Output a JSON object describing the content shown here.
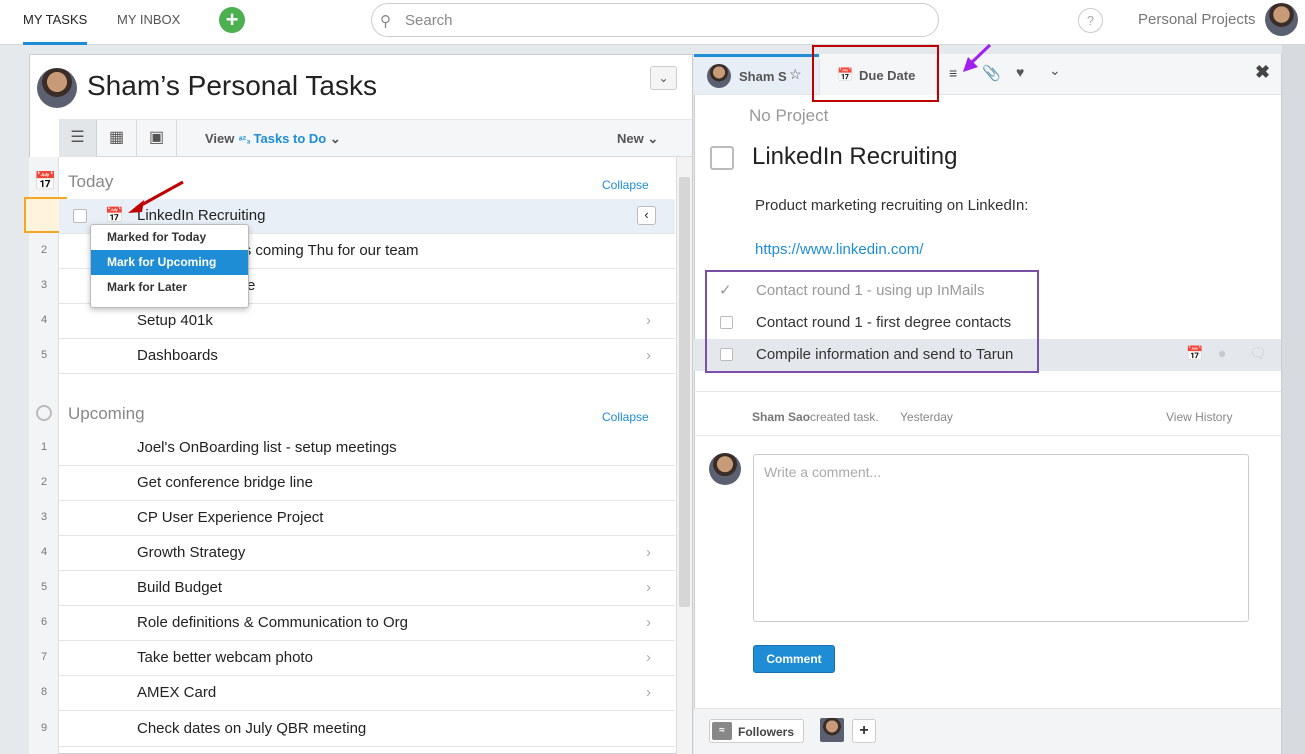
{
  "topnav": {
    "tabs": [
      "MY TASKS",
      "MY INBOX"
    ],
    "search_placeholder": "Search",
    "help": "?",
    "workspace": "Personal Projects"
  },
  "left": {
    "title": "Sham’s Personal Tasks",
    "view_label": "View",
    "view_value": "Tasks to Do",
    "new_label": "New",
    "today": {
      "header": "Today",
      "collapse": "Collapse",
      "tasks": [
        {
          "num": "",
          "title": "LinkedIn Recruiting",
          "chevron": false
        },
        {
          "num": "2",
          "title": "eam meeting this coming Thu for our team",
          "chevron": false
        },
        {
          "num": "3",
          "title": "email to signature",
          "chevron": false
        },
        {
          "num": "4",
          "title": "Setup 401k",
          "chevron": true
        },
        {
          "num": "5",
          "title": "Dashboards",
          "chevron": true
        }
      ]
    },
    "upcoming": {
      "header": "Upcoming",
      "collapse": "Collapse",
      "tasks": [
        {
          "num": "1",
          "title": "Joel's OnBoarding list - setup meetings",
          "chevron": false
        },
        {
          "num": "2",
          "title": "Get conference bridge line",
          "chevron": false
        },
        {
          "num": "3",
          "title": "CP User Experience Project",
          "chevron": false
        },
        {
          "num": "4",
          "title": "Growth Strategy",
          "chevron": true
        },
        {
          "num": "5",
          "title": "Build Budget",
          "chevron": true
        },
        {
          "num": "6",
          "title": "Role definitions & Communication to Org",
          "chevron": true
        },
        {
          "num": "7",
          "title": "Take better webcam photo",
          "chevron": true
        },
        {
          "num": "8",
          "title": "AMEX Card",
          "chevron": true
        },
        {
          "num": "9",
          "title": "Check dates on July QBR meeting",
          "chevron": false
        }
      ]
    },
    "context_menu": [
      "Marked for Today",
      "Mark for Upcoming",
      "Mark for Later"
    ]
  },
  "detail": {
    "assignee": "Sham S",
    "due_date": "Due Date",
    "project": "No Project",
    "title": "LinkedIn Recruiting",
    "description": "Product marketing recruiting on LinkedIn:",
    "link": "https://www.linkedin.com/",
    "subtasks": [
      {
        "title": "Contact round 1 - using up InMails",
        "done": true
      },
      {
        "title": "Contact round 1 - first degree contacts",
        "done": false
      },
      {
        "title": "Compile information and send to Tarun",
        "done": false
      }
    ],
    "activity": {
      "author": "Sham Sao",
      "action": "created task.",
      "time": "Yesterday",
      "history": "View History"
    },
    "comment_placeholder": "Write a comment...",
    "comment_button": "Comment",
    "followers": "Followers"
  },
  "colors": {
    "accent": "#1f8dd6",
    "annotation_red": "#c00000",
    "annotation_purple": "#7a4fa8",
    "arrow_purple": "#a020f0"
  }
}
